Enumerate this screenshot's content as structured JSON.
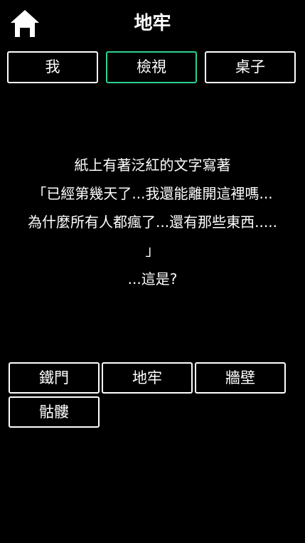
{
  "header": {
    "title": "地牢",
    "home_icon": "home-icon"
  },
  "tabs": [
    {
      "label": "我",
      "active": false
    },
    {
      "label": "檢視",
      "active": true
    },
    {
      "label": "桌子",
      "active": false
    }
  ],
  "message": {
    "lines": [
      "紙上有著泛紅的文字寫著",
      "「已經第幾天了...我還能離開這裡嗎...",
      "為什麼所有人都瘋了...還有那些東西.....",
      "」",
      "...這是?"
    ]
  },
  "actions": [
    {
      "label": "鐵門"
    },
    {
      "label": "地牢"
    },
    {
      "label": "牆壁"
    },
    {
      "label": "骷髏"
    }
  ],
  "colors": {
    "background": "#000000",
    "text": "#ffffff",
    "active_tab_border": "#2ed18e"
  }
}
